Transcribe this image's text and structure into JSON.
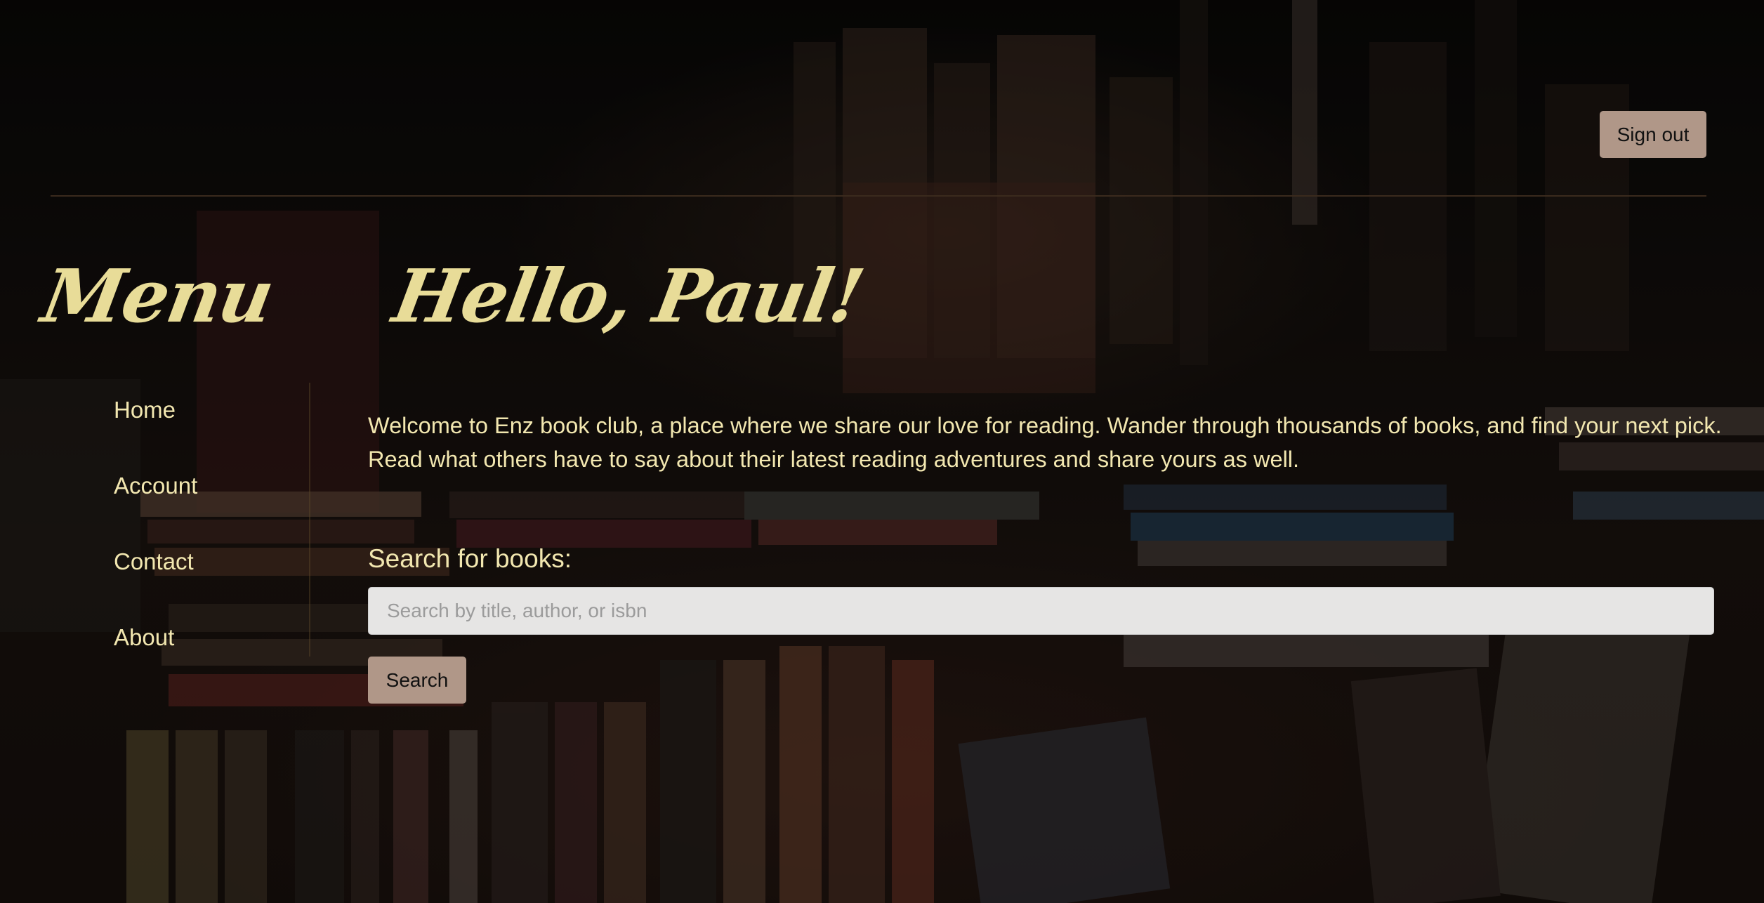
{
  "header": {
    "sign_out_label": "Sign out"
  },
  "sidebar": {
    "title": "Menu",
    "items": [
      {
        "label": "Home"
      },
      {
        "label": "Account"
      },
      {
        "label": "Contact"
      },
      {
        "label": "About"
      }
    ]
  },
  "main": {
    "greeting": "Hello, Paul!",
    "welcome_text": "Welcome to Enz book club, a place where we share our love for reading. Wander through thousands of books, and find your next pick. Read what others have to say about their latest reading adventures and share yours as well.",
    "search": {
      "label": "Search for books:",
      "placeholder": "Search by title, author, or isbn",
      "value": "",
      "button_label": "Search"
    }
  },
  "colors": {
    "accent_text": "#e8dc98",
    "body_text": "#f2e7b0",
    "button_bg": "#b09788",
    "input_bg": "#e6e5e4"
  }
}
